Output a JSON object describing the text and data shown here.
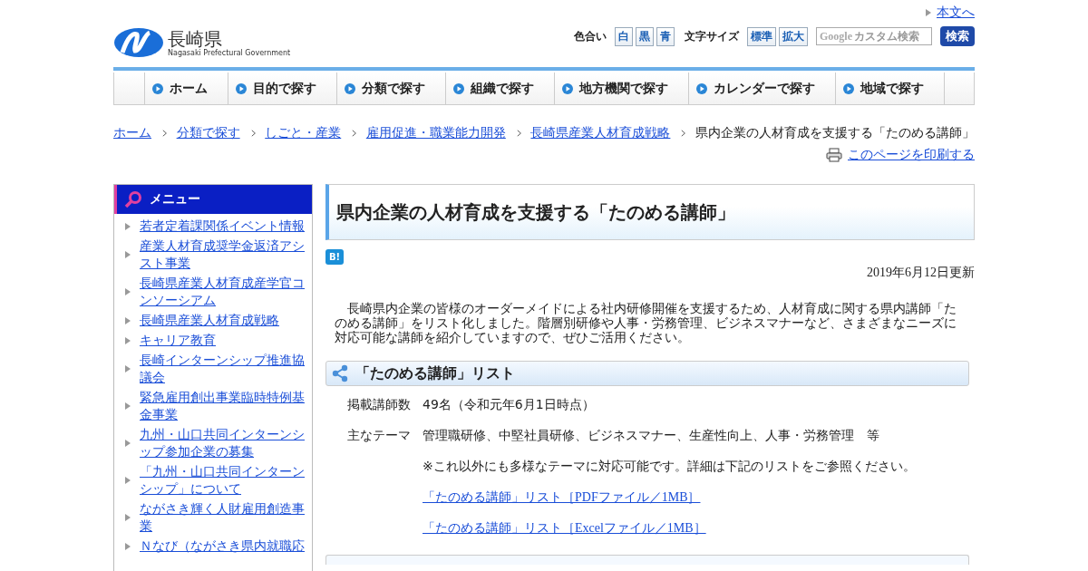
{
  "header": {
    "skip_link": "本文へ",
    "logo": {
      "name": "長崎県",
      "subtitle": "Nagasaki Prefectural Government"
    },
    "color_label": "色合い",
    "color_options": [
      "白",
      "黒",
      "青"
    ],
    "size_label": "文字サイズ",
    "size_options": [
      "標準",
      "拡大"
    ],
    "search": {
      "placeholder": "カスタム検索",
      "brand": "Google",
      "button": "検索"
    }
  },
  "nav": [
    "ホーム",
    "目的で探す",
    "分類で探す",
    "組織で探す",
    "地方機関で探す",
    "カレンダーで探す",
    "地域で探す"
  ],
  "breadcrumb": {
    "links": [
      "ホーム",
      "分類で探す",
      "しごと・産業",
      "雇用促進・職業能力開発",
      "長崎県産業人材育成戦略"
    ],
    "current": "県内企業の人材育成を支援する「たのめる講師」"
  },
  "print_link": "このページを印刷する",
  "sidebar": {
    "title": "メニュー",
    "items": [
      "若者定着課関係イベント情報",
      "産業人材育成奨学金返済アシスト事業",
      "長崎県産業人材育成産学官コンソーシアム",
      "長崎県産業人材育成戦略",
      "キャリア教育",
      "長崎インターンシップ推進協議会",
      "緊急雇用創出事業臨時特例基金事業",
      "九州・山口共同インターンシップ参加企業の募集",
      "「九州・山口共同インターンシップ」について",
      "ながさき輝く人財雇用創造事業",
      "Ｎなび（ながさき県内就職応"
    ]
  },
  "main": {
    "title": "県内企業の人材育成を支援する「たのめる講師」",
    "bookmark_badge": "B!",
    "updated": "2019年6月12日更新",
    "intro": "長崎県内企業の皆様のオーダーメイドによる社内研修開催を支援するため、人材育成に関する県内講師「たのめる講師」をリスト化しました。階層別研修や人事・労務管理、ビジネスマナーなど、さまざまなニーズに対応可能な講師を紹介していますので、ぜひご活用ください。",
    "section": {
      "title": "「たのめる講師」リスト",
      "rows": [
        {
          "kind": "field",
          "label": "掲載講師数",
          "value": "49名（令和元年6月1日時点）"
        },
        {
          "kind": "field",
          "label": "主なテーマ",
          "value": "管理職研修、中堅社員研修、ビジネスマナー、生産性向上、人事・労務管理　等"
        },
        {
          "kind": "note",
          "value": "※これ以外にも多様なテーマに対応可能です。詳細は下記のリストをご参照ください。"
        },
        {
          "kind": "link",
          "value": "「たのめる講師」リスト［PDFファイル／1MB］"
        },
        {
          "kind": "link",
          "value": "「たのめる講師」リスト［Excelファイル／1MB］"
        }
      ]
    }
  }
}
